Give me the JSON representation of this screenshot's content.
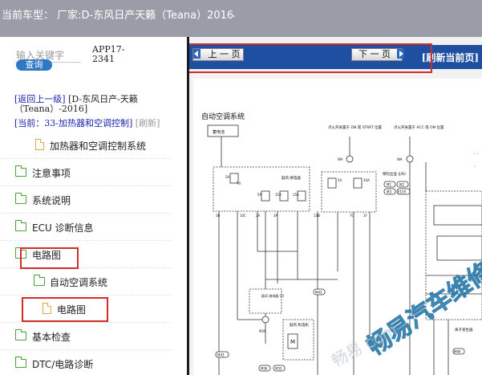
{
  "window": {
    "title": "当前车型：  厂家:D-东风日产天籁（Teana）2016"
  },
  "search": {
    "label": "输入关键字",
    "button": "查询",
    "app_id": "APP17-2341"
  },
  "breadcrumb": {
    "up_link": "[返回上一级]",
    "up_target": "[D-东风日产-天籁（Teana）-2016]",
    "current_label": "[当前：33-加热器和空调控制]",
    "refresh": "[刷新]"
  },
  "tree": [
    {
      "label": "加热器和空调控制系统",
      "type": "doc",
      "level": 2
    },
    {
      "label": "注意事项",
      "type": "folder",
      "level": 0
    },
    {
      "label": "系统说明",
      "type": "folder",
      "level": 0
    },
    {
      "label": "ECU 诊断信息",
      "type": "folder",
      "level": 0
    },
    {
      "label": "电路图",
      "type": "folder",
      "level": 0
    },
    {
      "label": "自动空调系统",
      "type": "folder",
      "level": 1
    },
    {
      "label": "电路图",
      "type": "doc",
      "level": 1
    },
    {
      "label": "基本检查",
      "type": "folder",
      "level": 0
    },
    {
      "label": "DTC/电路诊断",
      "type": "folder",
      "level": 0
    }
  ],
  "viewer": {
    "prev_button": "上 一 页",
    "next_button": "下 一 页",
    "refresh_button": "[刷新当前页]"
  },
  "diagram": {
    "title": "自动空调系统",
    "labels": {
      "battery": "蓄电池",
      "ign_on": "点火开关置于 ON 或 START 位置",
      "acc_on": "点火开关置于 ACC 或 ON 位置",
      "fuse_5a_1": "5A",
      "fuse_t4": "T4",
      "blower_relay": "鼓风 继电器",
      "fuse_5a_2": "5A",
      "fuse_15a_1": "15A",
      "fuse_15a_2": "15A",
      "fuse_5a_3": "5A",
      "fuse_10a": "10A",
      "fuse_box": "保险丝盒 (J/B)",
      "fuse_5a_4": "5A",
      "connectors": [
        "M1",
        "M2",
        "M3",
        "E103"
      ],
      "wa": "WA",
      "wa2": "WA",
      "relay2": "鼓风 继电器 (2)",
      "blower_motor": "鼓风 机电机",
      "m43": "M43",
      "m26": "M26",
      "m35": "M35",
      "m56": "M56",
      "m84": "M84",
      "m43b": "M43",
      "ccontrol": "离子发生器",
      "ids": [
        "3B",
        "10C",
        "2A",
        "3A",
        "13B",
        "7C",
        "1F"
      ]
    }
  },
  "watermark": {
    "main": "畅易汽车维修",
    "sub": "畅易 com"
  },
  "colors": {
    "titlebar": "#9a9da8",
    "toolbar": "#1e4fa0",
    "link": "#1a25b0",
    "highlight": "#d42b2b",
    "folder_icon": "#4aa238",
    "doc_icon": "#e4a640",
    "query_button": "#2f79c4"
  }
}
